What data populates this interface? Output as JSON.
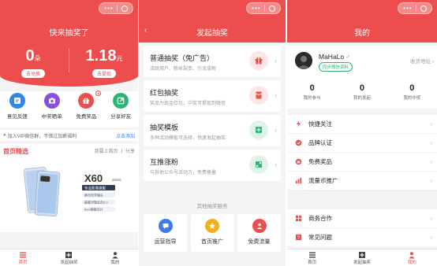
{
  "home": {
    "nav_title": "快来抽奖了",
    "gift_value": "0",
    "gift_unit": "朵",
    "gift_btn": "去兑换",
    "cash_value": "1.18",
    "cash_unit": "元",
    "cash_btn": "去提现",
    "shortcuts": [
      {
        "label": "意见反馈",
        "color": "#2f86e6"
      },
      {
        "label": "中奖晒单",
        "color": "#8a4fe0"
      },
      {
        "label": "免费奖品",
        "color": "#ee4d4d"
      },
      {
        "label": "分享好友",
        "color": "#2bb673"
      }
    ],
    "notice_text": "加入VIP微信群，不错过加薪福利",
    "notice_link": "点击添加",
    "featured_title": "首页精选",
    "featured_links": "我要上首页 丨 分享",
    "promo_model": "X60",
    "promo_lines": [
      "专业影像旗舰",
      "蔡司光学镜头",
      "超感光微云台2.0",
      "5nm旗舰芯片"
    ]
  },
  "tabs_left": [
    {
      "label": "首页",
      "icon": "menu-icon"
    },
    {
      "label": "发起抽奖",
      "icon": "plus-box-icon"
    },
    {
      "label": "我的",
      "icon": "user-icon"
    }
  ],
  "create": {
    "nav_title": "发起抽奖",
    "cards": [
      {
        "title": "普通抽奖（免广告）",
        "sub": "活跃用户、粉丝裂变、引流涨粉",
        "color": "#ee4d4d",
        "icon": "gift-icon"
      },
      {
        "title": "红包抽奖",
        "sub": "奖品为现金红包，中奖可提现到微信",
        "color": "#ee4d4d",
        "icon": "red-envelope-icon"
      },
      {
        "title": "抽奖模板",
        "sub": "多种活动模板可选择，快速发起抽奖",
        "color": "#2bb673",
        "icon": "template-icon"
      },
      {
        "title": "互推涨粉",
        "sub": "与其他公众号活动方，免费换量",
        "color": "#2bb673",
        "icon": "swap-icon"
      }
    ],
    "other_title": "其他抽奖服务",
    "services": [
      {
        "label": "运营指导",
        "color": "#3d7cf0",
        "icon": "chat-icon"
      },
      {
        "label": "首页推广",
        "color": "#f2b01e",
        "icon": "star-icon"
      },
      {
        "label": "免费流量",
        "color": "#ee4d4d",
        "icon": "person-icon"
      }
    ]
  },
  "profile": {
    "nav_title": "我的",
    "username": "MaHaLo",
    "gender": "♂",
    "sync_label": "同步微信资料",
    "address_link": "收货地址",
    "counts": [
      {
        "n": "0",
        "label": "我的参与"
      },
      {
        "n": "0",
        "label": "我的发起"
      },
      {
        "n": "0",
        "label": "我的中奖"
      }
    ],
    "menu_a": [
      {
        "label": "快捷关注",
        "icon": "bolt-icon"
      },
      {
        "label": "品牌认证",
        "icon": "shield-icon"
      },
      {
        "label": "免费奖品",
        "icon": "gift-icon"
      },
      {
        "label": "流量币推广",
        "icon": "bar-chart-icon"
      }
    ],
    "menu_b": [
      {
        "label": "商务合作",
        "icon": "grid-icon"
      },
      {
        "label": "常见问题",
        "icon": "question-icon"
      }
    ]
  },
  "tabs_right": [
    {
      "label": "首页",
      "icon": "menu-icon"
    },
    {
      "label": "发起抽奖",
      "icon": "plus-box-icon"
    },
    {
      "label": "我的",
      "icon": "user-icon"
    }
  ],
  "accent": "#ee4d4d"
}
